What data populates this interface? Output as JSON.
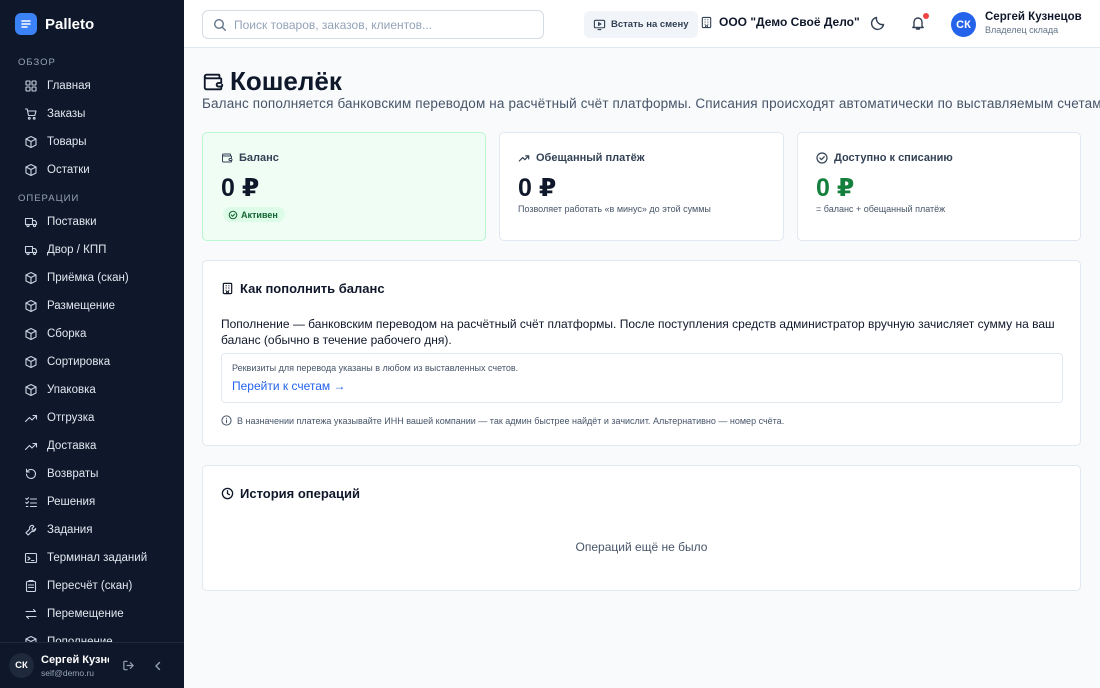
{
  "brand": {
    "name": "Palleto",
    "logo_icon": "list-logo-icon"
  },
  "sidebar": {
    "sections": [
      {
        "title": "ОБЗОР",
        "items": [
          {
            "label": "Главная",
            "icon": "grid-icon"
          },
          {
            "label": "Заказы",
            "icon": "cart-icon"
          },
          {
            "label": "Товары",
            "icon": "box-icon"
          },
          {
            "label": "Остатки",
            "icon": "box-icon"
          }
        ]
      },
      {
        "title": "ОПЕРАЦИИ",
        "items": [
          {
            "label": "Поставки",
            "icon": "truck-icon"
          },
          {
            "label": "Двор / КПП",
            "icon": "truck-icon"
          },
          {
            "label": "Приёмка (скан)",
            "icon": "box-icon"
          },
          {
            "label": "Размещение",
            "icon": "box-icon"
          },
          {
            "label": "Сборка",
            "icon": "box-icon"
          },
          {
            "label": "Сортировка",
            "icon": "box-icon"
          },
          {
            "label": "Упаковка",
            "icon": "box-icon"
          },
          {
            "label": "Отгрузка",
            "icon": "trend-icon"
          },
          {
            "label": "Доставка",
            "icon": "trend-icon"
          },
          {
            "label": "Возвраты",
            "icon": "undo-icon"
          },
          {
            "label": "Решения",
            "icon": "list-check-icon"
          },
          {
            "label": "Задания",
            "icon": "wrench-icon"
          },
          {
            "label": "Терминал заданий",
            "icon": "terminal-icon"
          },
          {
            "label": "Пересчёт (скан)",
            "icon": "clipboard-icon"
          },
          {
            "label": "Перемещение",
            "icon": "swap-icon"
          },
          {
            "label": "Пополнение",
            "icon": "box-icon"
          }
        ]
      }
    ],
    "footer": {
      "initials": "СК",
      "name": "Сергей Кузнецов",
      "email": "self@demo.ru"
    }
  },
  "header": {
    "search_placeholder": "Поиск товаров, заказов, клиентов...",
    "shift_button": "Встать на смену",
    "org_name": "ООО \"Демо Своё Дело\"",
    "user": {
      "initials": "СК",
      "name": "Сергей Кузнецов",
      "role": "Владелец склада"
    }
  },
  "page": {
    "title": "Кошелёк",
    "subtitle": "Баланс пополняется банковским переводом на расчётный счёт платформы. Списания происходят автоматически по выставляемым счетам."
  },
  "stats": {
    "balance": {
      "label": "Баланс",
      "value": "0 ₽",
      "badge": "Активен"
    },
    "promised": {
      "label": "Обещанный платёж",
      "value": "0 ₽",
      "note": "Позволяет работать «в минус» до этой суммы"
    },
    "available": {
      "label": "Доступно к списанию",
      "value": "0 ₽",
      "note": "= баланс + обещанный платёж"
    }
  },
  "topup": {
    "title": "Как пополнить баланс",
    "text": "Пополнение — банковским переводом на расчётный счёт платформы. После поступления средств администратор вручную зачисляет сумму на ваш баланс (обычно в течение рабочего дня).",
    "requisites_text": "Реквизиты для перевода указаны в любом из выставленных счетов.",
    "link": "Перейти к счетам →",
    "hint": "В назначении платежа указывайте ИНН вашей компании — так админ быстрее найдёт и зачислит. Альтернативно — номер счёта."
  },
  "history": {
    "title": "История операций",
    "empty": "Операций ещё не было"
  },
  "colors": {
    "sidebar": "#0f172a",
    "accent": "#2563eb",
    "success": "#15803d",
    "notify_dot": "#ef4444"
  }
}
